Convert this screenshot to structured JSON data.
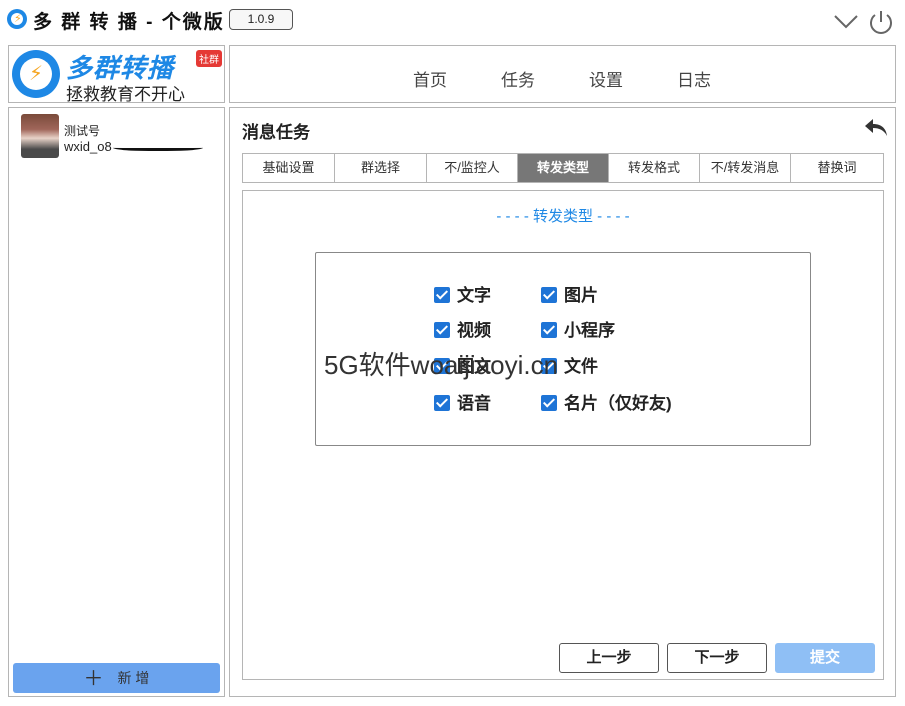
{
  "app": {
    "title": "多 群 转 播 - 个微版",
    "version": "1.0.9"
  },
  "logo": {
    "name": "多群转播",
    "badge": "社群",
    "slogan": "拯救教育不开心"
  },
  "nav": {
    "items": [
      "首页",
      "任务",
      "设置",
      "日志"
    ]
  },
  "account": {
    "name": "测试号",
    "id": "wxid_o8"
  },
  "sidebar": {
    "add_label": "新 增",
    "add_icon": "plus-icon"
  },
  "main": {
    "title": "消息任务",
    "back_icon": "back-arrow-icon",
    "tabs": [
      {
        "label": "基础设置",
        "active": false
      },
      {
        "label": "群选择",
        "active": false
      },
      {
        "label": "不/监控人",
        "active": false
      },
      {
        "label": "转发类型",
        "active": true
      },
      {
        "label": "转发格式",
        "active": false
      },
      {
        "label": "不/转发消息",
        "active": false
      },
      {
        "label": "替换词",
        "active": false
      }
    ],
    "section_title": "- - - -  转发类型  - - - -",
    "options": [
      {
        "label": "文字",
        "checked": true
      },
      {
        "label": "图片",
        "checked": true
      },
      {
        "label": "视频",
        "checked": true
      },
      {
        "label": "小程序",
        "checked": true
      },
      {
        "label": "图文",
        "checked": true
      },
      {
        "label": "文件",
        "checked": true
      },
      {
        "label": "语音",
        "checked": true
      },
      {
        "label": "名片（仅好友)",
        "checked": true
      }
    ],
    "buttons": {
      "prev": "上一步",
      "next": "下一步",
      "submit": "提交"
    }
  },
  "watermark": "5G软件woaijiaoyi.cn",
  "colors": {
    "accent": "#1e88e5",
    "active_tab": "#777777",
    "submit": "#8fbff5",
    "add_button": "#6aa3ee"
  }
}
